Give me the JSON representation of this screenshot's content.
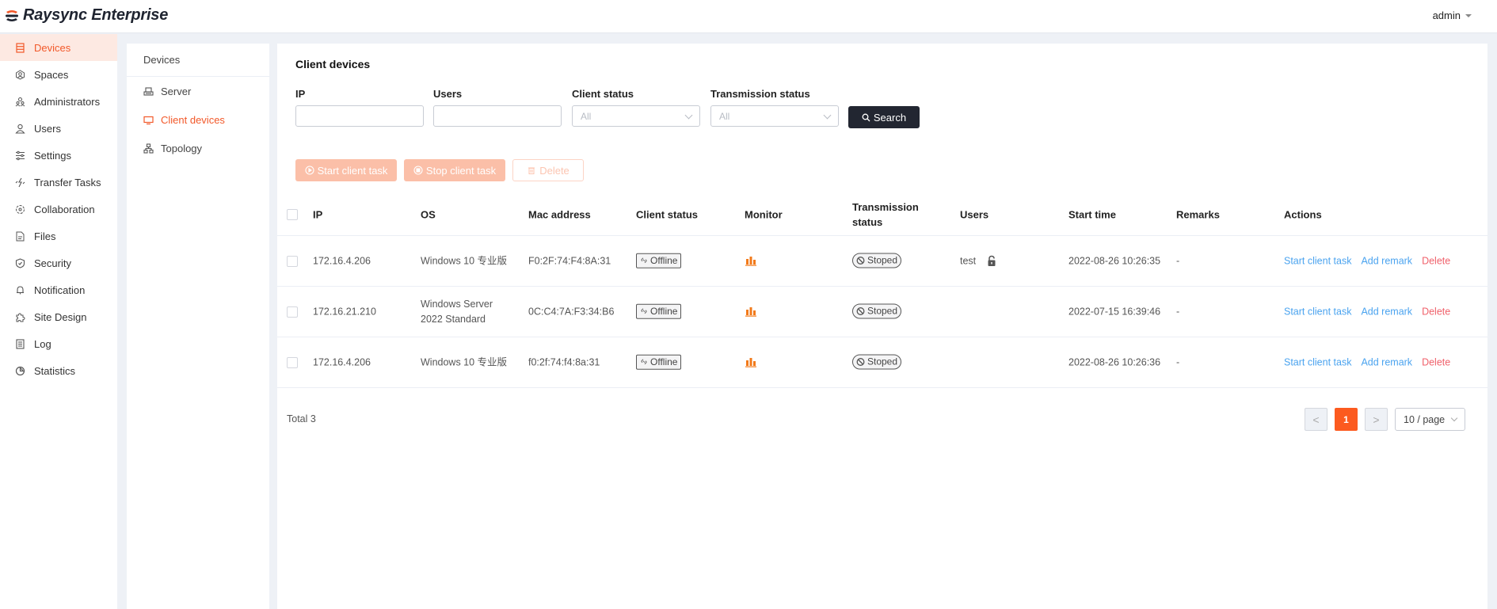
{
  "app": {
    "title": "Raysync Enterprise",
    "brand_color": "#f2592a"
  },
  "header": {
    "user": "admin"
  },
  "sidebar": {
    "items": [
      {
        "label": "Devices",
        "icon": "server-list-icon",
        "active": true
      },
      {
        "label": "Spaces",
        "icon": "spaces-icon"
      },
      {
        "label": "Administrators",
        "icon": "administrators-icon"
      },
      {
        "label": "Users",
        "icon": "user-icon"
      },
      {
        "label": "Settings",
        "icon": "sliders-icon"
      },
      {
        "label": "Transfer Tasks",
        "icon": "transfer-icon"
      },
      {
        "label": "Collaboration",
        "icon": "collaboration-icon"
      },
      {
        "label": "Files",
        "icon": "file-icon"
      },
      {
        "label": "Security",
        "icon": "shield-icon"
      },
      {
        "label": "Notification",
        "icon": "bell-icon"
      },
      {
        "label": "Site Design",
        "icon": "puzzle-icon"
      },
      {
        "label": "Log",
        "icon": "log-icon"
      },
      {
        "label": "Statistics",
        "icon": "pie-chart-icon"
      }
    ]
  },
  "submenu": {
    "title": "Devices",
    "items": [
      {
        "label": "Server",
        "icon": "server-icon"
      },
      {
        "label": "Client devices",
        "icon": "monitor-icon",
        "active": true
      },
      {
        "label": "Topology",
        "icon": "topology-icon"
      }
    ]
  },
  "main": {
    "title": "Client devices",
    "filters": {
      "ip": {
        "label": "IP",
        "value": "",
        "placeholder": ""
      },
      "users": {
        "label": "Users",
        "value": "",
        "placeholder": ""
      },
      "client_status": {
        "label": "Client status",
        "value": "All"
      },
      "transmission_status": {
        "label": "Transmission status",
        "value": "All"
      },
      "search_label": "Search"
    },
    "actions": {
      "start": "Start client task",
      "stop": "Stop client task",
      "delete": "Delete"
    },
    "table": {
      "columns": [
        "IP",
        "OS",
        "Mac address",
        "Client status",
        "Monitor",
        "Transmission status",
        "Users",
        "Start time",
        "Remarks",
        "Actions"
      ],
      "rows": [
        {
          "ip": "172.16.4.206",
          "os": "Windows 10 专业版",
          "mac": "F0:2F:74:F4:8A:31",
          "client_status": "Offline",
          "transmission_status": "Stoped",
          "users": "test",
          "locked": false,
          "start_time": "2022-08-26 10:26:35",
          "remarks": "-"
        },
        {
          "ip": "172.16.21.210",
          "os": "Windows Server 2022 Standard",
          "mac": "0C:C4:7A:F3:34:B6",
          "client_status": "Offline",
          "transmission_status": "Stoped",
          "users": "",
          "start_time": "2022-07-15 16:39:46",
          "remarks": "-"
        },
        {
          "ip": "172.16.4.206",
          "os": "Windows 10 专业版",
          "mac": "f0:2f:74:f4:8a:31",
          "client_status": "Offline",
          "transmission_status": "Stoped",
          "users": "",
          "start_time": "2022-08-26 10:26:36",
          "remarks": "-"
        }
      ],
      "row_actions": {
        "start": "Start client task",
        "remark": "Add remark",
        "delete": "Delete"
      }
    },
    "pagination": {
      "total": "Total 3",
      "current_page": "1",
      "prev": "<",
      "next": ">",
      "page_size": "10 / page"
    }
  }
}
